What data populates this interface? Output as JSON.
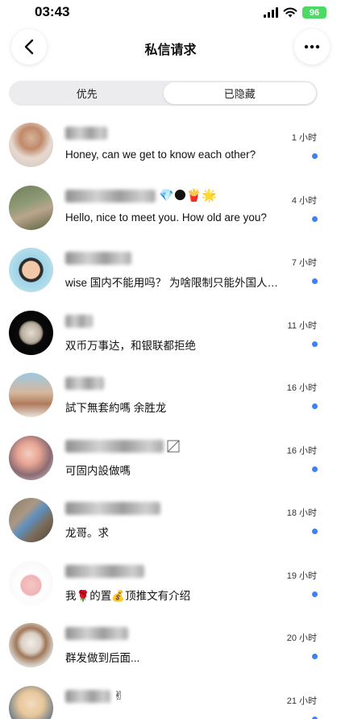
{
  "status_bar": {
    "time": "03:43",
    "battery": "96"
  },
  "header": {
    "title": "私信请求",
    "back_icon": "chevron-left-icon",
    "more_icon": "more-horizontal-icon"
  },
  "tabs": [
    {
      "label": "优先",
      "active": false
    },
    {
      "label": "已隐藏",
      "active": true
    }
  ],
  "colors": {
    "unread_dot": "#3b82f6",
    "battery": "#4cd964",
    "segment_bg": "#ececee"
  },
  "conversations": [
    {
      "time": "1 小时",
      "message": "Honey, can we get to know each other?",
      "unread": true,
      "name_emojis": ""
    },
    {
      "time": "4 小时",
      "message": "Hello, nice to meet you. How old are you?",
      "unread": true,
      "name_emojis": "💎🌑🍟🌟"
    },
    {
      "time": "7 小时",
      "message": "wise 国内不能用吗？ 为啥限制只能外国人…",
      "unread": true,
      "name_emojis": ""
    },
    {
      "time": "11 小时",
      "message": "双币万事达，和银联都拒绝",
      "unread": true,
      "name_emojis": ""
    },
    {
      "time": "16 小时",
      "message": "試下無套約嗎 余胜龙",
      "unread": true,
      "name_emojis": ""
    },
    {
      "time": "16 小时",
      "message": "可固内設做嗎",
      "unread": true,
      "name_emojis": ""
    },
    {
      "time": "18 小时",
      "message": "龙哥。求",
      "unread": true,
      "name_emojis": ""
    },
    {
      "time": "19 小时",
      "message": "我🌹的置💰顶推文有介绍",
      "unread": true,
      "name_emojis": ""
    },
    {
      "time": "20 小时",
      "message": "群发做到后面...",
      "unread": true,
      "name_emojis": ""
    },
    {
      "time": "21 小时",
      "message": "",
      "unread": true,
      "name_emojis": "✌"
    }
  ]
}
